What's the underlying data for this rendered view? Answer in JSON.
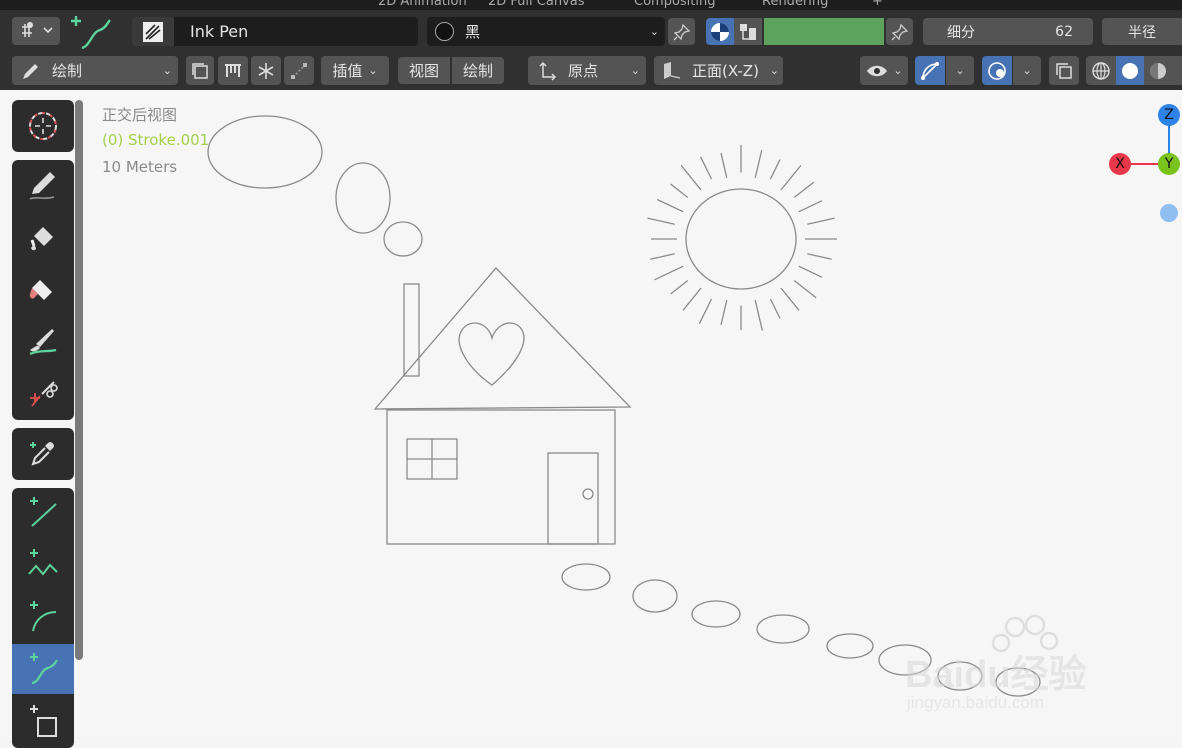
{
  "tabs": [
    "2D Animation",
    "2D Full Canvas",
    "Compositing",
    "Rendering",
    "+"
  ],
  "header1": {
    "brush_name": "Ink Pen",
    "material_name": "黑",
    "subdivide_label": "细分",
    "subdivide_value": "62",
    "radius_label": "半径"
  },
  "header2": {
    "mode_label": "绘制",
    "interpolate_label": "插值",
    "view_label": "视图",
    "draw_label": "绘制",
    "origin_label": "原点",
    "plane_label": "正面(X-Z)"
  },
  "viewport": {
    "view_name": "正交后视图",
    "object_name": "(0) Stroke.001",
    "scale": "10 Meters"
  },
  "gizmo": {
    "z": "Z",
    "x": "X",
    "y": "Y"
  },
  "watermark": {
    "brand": "Baidu经验",
    "url": "jingyan.baidu.com"
  },
  "colors": {
    "accent": "#4772b3",
    "green_swatch": "#5da25d",
    "object_green": "#a6d04a",
    "gizmo_x": "#e8374a",
    "gizmo_y": "#7ac21c",
    "gizmo_z": "#2e83e8"
  },
  "icons": [
    "cursor-icon",
    "draw-icon",
    "fill-icon",
    "erase-icon",
    "tint-icon",
    "cutter-icon",
    "eyedropper-icon",
    "line-icon",
    "polyline-icon",
    "arc-icon",
    "curve-icon",
    "box-icon"
  ]
}
